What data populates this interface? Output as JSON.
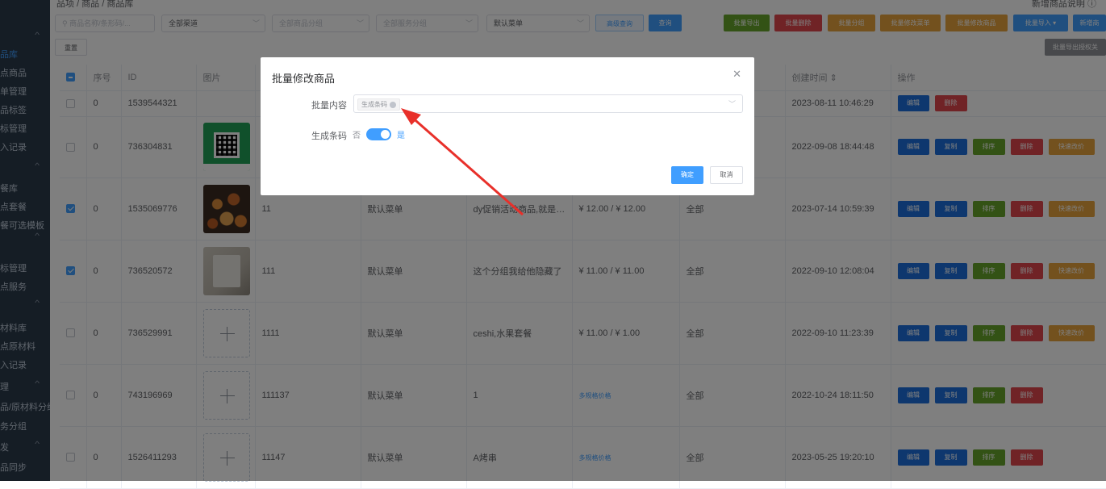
{
  "sidebar": {
    "items": [
      {
        "label": "品库",
        "active": true
      },
      {
        "label": "点商品",
        "active": false
      },
      {
        "label": "单管理",
        "active": false
      },
      {
        "label": "品标签",
        "active": false
      },
      {
        "label": "标管理",
        "active": false
      },
      {
        "label": "入记录",
        "active": false
      },
      {
        "label": "餐库",
        "active": false
      },
      {
        "label": "点套餐",
        "active": false
      },
      {
        "label": "餐可选模板",
        "active": false
      },
      {
        "label": "标管理",
        "active": false
      },
      {
        "label": "点服务",
        "active": false
      },
      {
        "label": "材料库",
        "active": false
      },
      {
        "label": "点原材料",
        "active": false
      },
      {
        "label": "入记录",
        "active": false
      },
      {
        "label": "理",
        "active": false
      },
      {
        "label": "品/原材料分组",
        "active": false
      },
      {
        "label": "务分组",
        "active": false
      },
      {
        "label": "发",
        "active": false
      },
      {
        "label": "品同步",
        "active": false
      }
    ]
  },
  "breadcrumb": "品项 / 商品 / 商品库",
  "help_text": "新增商品说明",
  "filters": {
    "search_placeholder": "商品名称/条形码/...",
    "channel": "全部渠道",
    "goods_group_placeholder": "全部商品分组",
    "service_group_placeholder": "全部服务分组",
    "menu": "默认菜单"
  },
  "toolbar": {
    "advanced_search": "高级查询",
    "search": "查询",
    "batch_export": "批量导出",
    "batch_delete": "批量删除",
    "batch_group": "批量分组",
    "batch_edit_menu": "批量修改菜单",
    "batch_edit_goods": "批量修改商品",
    "batch_import": "批量导入",
    "add_goods": "新增商",
    "reset": "重置",
    "batch_export_auth": "批量导出授权关"
  },
  "table": {
    "headers": [
      "序号",
      "ID",
      "图片",
      "",
      "",
      "",
      "",
      "",
      "创建时间",
      "操作"
    ],
    "rows": [
      {
        "checked": false,
        "seq": "0",
        "id": "1539544321",
        "img": "none",
        "name": "",
        "menu": "",
        "group": "",
        "price": "",
        "price_link": false,
        "channel": "",
        "created": "2023-08-11 10:46:29",
        "ops": [
          "编辑",
          "删除"
        ]
      },
      {
        "checked": false,
        "seq": "0",
        "id": "736304831",
        "img": "qr",
        "name": "",
        "menu": "",
        "group": "",
        "price": "",
        "price_link": false,
        "channel": "",
        "created": "2022-09-08 18:44:48",
        "ops": [
          "编辑",
          "复制",
          "排序",
          "删除",
          "快速改价"
        ]
      },
      {
        "checked": true,
        "seq": "0",
        "id": "1535069776",
        "img": "food",
        "name": "11",
        "menu": "默认菜单",
        "group": "dy促销活动商品,就是要...",
        "price": "¥ 12.00 / ¥ 12.00",
        "price_link": false,
        "channel": "全部",
        "created": "2023-07-14 10:59:39",
        "ops": [
          "编辑",
          "复制",
          "排序",
          "删除",
          "快速改价"
        ]
      },
      {
        "checked": true,
        "seq": "0",
        "id": "736520572",
        "img": "paper",
        "name": "111",
        "menu": "默认菜单",
        "group": "这个分组我给他隐藏了",
        "price": "¥ 11.00 / ¥ 11.00",
        "price_link": false,
        "channel": "全部",
        "created": "2022-09-10 12:08:04",
        "ops": [
          "编辑",
          "复制",
          "排序",
          "删除",
          "快速改价"
        ]
      },
      {
        "checked": false,
        "seq": "0",
        "id": "736529991",
        "img": "placeholder",
        "name": "1111",
        "menu": "默认菜单",
        "group": "ceshi,水果套餐",
        "price": "¥ 11.00 / ¥ 1.00",
        "price_link": false,
        "channel": "全部",
        "created": "2022-09-10 11:23:39",
        "ops": [
          "编辑",
          "复制",
          "排序",
          "删除",
          "快速改价"
        ]
      },
      {
        "checked": false,
        "seq": "0",
        "id": "743196969",
        "img": "placeholder",
        "name": "111137",
        "menu": "默认菜单",
        "group": "1",
        "price": "多规格价格",
        "price_link": true,
        "channel": "全部",
        "created": "2022-10-24 18:11:50",
        "ops": [
          "编辑",
          "复制",
          "排序",
          "删除"
        ]
      },
      {
        "checked": false,
        "seq": "0",
        "id": "1526411293",
        "img": "placeholder",
        "name": "11147",
        "menu": "默认菜单",
        "group": "A烤串",
        "price": "多规格价格",
        "price_link": true,
        "channel": "全部",
        "created": "2023-05-25 19:20:10",
        "ops": [
          "编辑",
          "复制",
          "排序",
          "删除"
        ]
      }
    ]
  },
  "dialog": {
    "title": "批量修改商品",
    "content_label": "批量内容",
    "content_tag": "生成条码",
    "barcode_label": "生成条码",
    "switch_off": "否",
    "switch_on": "是",
    "switch_value": true,
    "confirm": "确定",
    "cancel": "取消"
  },
  "colors": {
    "primary": "#409eff",
    "edit": "#1d6fdc",
    "green": "#67a52b",
    "red": "#e0464c",
    "orange": "#e6a23c",
    "sidebar_bg": "#2b3a4b",
    "annotation_arrow": "#e8302a"
  }
}
